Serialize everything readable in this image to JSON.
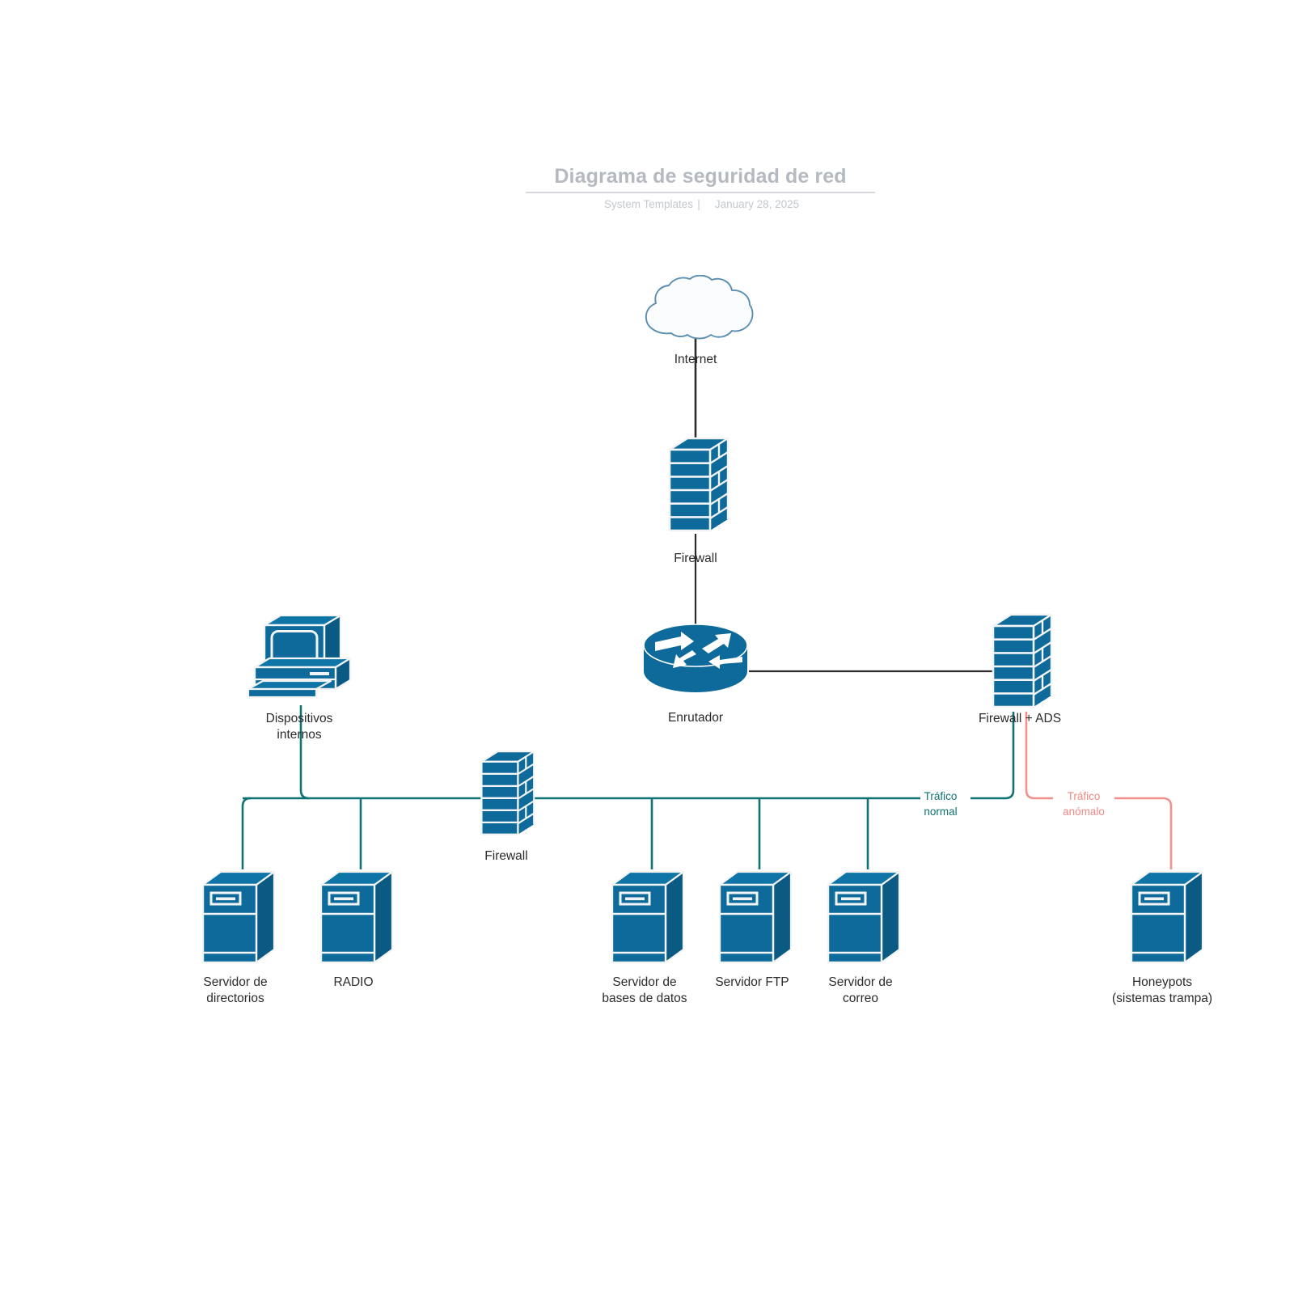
{
  "header": {
    "title": "Diagrama de seguridad de red",
    "byline": "System Templates",
    "separator": "|",
    "date": "January 28, 2025"
  },
  "colors": {
    "device_blue": "#0d6a9a",
    "device_blue_dark": "#0a5a84",
    "device_outline": "#f2f4f5",
    "cloud_stroke": "#5a8fb0",
    "cloud_fill": "#fbfcfd",
    "link_black": "#2b2b2b",
    "link_normal": "#0f7274",
    "link_anomalous": "#f2918c",
    "title_gray": "#b5bac1",
    "label_dark": "#2b2b2b"
  },
  "legend": {
    "normal": {
      "line1": "Tráfico",
      "line2": "normal"
    },
    "anomalous": {
      "line1": "Tráfico",
      "line2": "anómalo"
    }
  },
  "nodes": [
    {
      "id": "internet",
      "icon": "cloud-icon",
      "label": [
        "Internet"
      ]
    },
    {
      "id": "firewall-top",
      "icon": "firewall-icon",
      "label": [
        "Firewall"
      ]
    },
    {
      "id": "router",
      "icon": "router-icon",
      "label": [
        "Enrutador"
      ]
    },
    {
      "id": "firewall-ads",
      "icon": "firewall-icon",
      "label": [
        "Firewall + ADS"
      ]
    },
    {
      "id": "internal-devices",
      "icon": "desktop-computer-icon",
      "label": [
        "Dispositivos",
        "internos"
      ]
    },
    {
      "id": "firewall-mid",
      "icon": "firewall-icon",
      "label": [
        "Firewall"
      ]
    },
    {
      "id": "directory-server",
      "icon": "server-icon",
      "label": [
        "Servidor de",
        "directorios"
      ]
    },
    {
      "id": "radio-server",
      "icon": "server-icon",
      "label": [
        "RADIO"
      ]
    },
    {
      "id": "database-server",
      "icon": "server-icon",
      "label": [
        "Servidor de",
        "bases de datos"
      ]
    },
    {
      "id": "ftp-server",
      "icon": "server-icon",
      "label": [
        "Servidor FTP"
      ]
    },
    {
      "id": "mail-server",
      "icon": "server-icon",
      "label": [
        "Servidor de",
        "correo"
      ]
    },
    {
      "id": "honeypots",
      "icon": "server-icon",
      "label": [
        "Honeypots",
        "(sistemas trampa)"
      ]
    }
  ],
  "links": [
    {
      "from": "internet",
      "to": "firewall-top",
      "kind": "black"
    },
    {
      "from": "firewall-top",
      "to": "router",
      "kind": "black"
    },
    {
      "from": "router",
      "to": "firewall-ads",
      "kind": "black"
    },
    {
      "from": "firewall-ads",
      "to": "bus",
      "kind": "normal"
    },
    {
      "from": "firewall-ads",
      "to": "honeypots",
      "kind": "anomalous"
    },
    {
      "from": "internal-devices",
      "to": "bus",
      "kind": "normal"
    },
    {
      "from": "bus",
      "to": "directory-server",
      "kind": "normal"
    },
    {
      "from": "bus",
      "to": "radio-server",
      "kind": "normal"
    },
    {
      "from": "bus",
      "to": "database-server",
      "kind": "normal"
    },
    {
      "from": "bus",
      "to": "ftp-server",
      "kind": "normal"
    },
    {
      "from": "bus",
      "to": "mail-server",
      "kind": "normal"
    }
  ]
}
